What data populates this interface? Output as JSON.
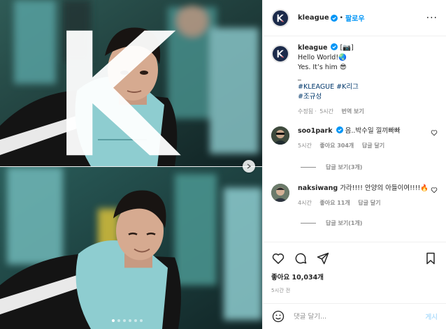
{
  "post": {
    "username": "kleague",
    "follow_label": "팔로우",
    "more_icon": "more-horizontal-icon",
    "caption": {
      "username": "kleague",
      "badge": "[📷]",
      "line1": "Hello World!🌏",
      "line2": "Yes. It’s him 😎",
      "line3": "_",
      "tags1": "#KLEAGUE #K리그",
      "tags2": "#조규성",
      "edited": "수정됨",
      "time": "5시간",
      "translate": "번역 보기"
    },
    "comments": [
      {
        "username": "soo1park",
        "text": "음..박수일 낄끼빠빠",
        "time": "5시간",
        "likes": "좋아요 304개",
        "reply": "답글 달기",
        "view_replies": "답글 보기(3개)"
      },
      {
        "username": "naksiwang",
        "text": "가라!!!! 안양의 아들이여!!!!🔥",
        "time": "4시간",
        "likes": "좋아요 11개",
        "reply": "답글 달기",
        "view_replies": "답글 보기(1개)"
      }
    ],
    "likes_total": "좋아요 10,034개",
    "posted_ago": "5시간 전",
    "add_comment_placeholder": "댓글 달기...",
    "post_button": "게시"
  },
  "colors": {
    "link_blue": "#0095f6",
    "hashtag": "#00376b",
    "muted": "#8e8e8e",
    "kleague_navy": "#1b2a4a",
    "bib_teal": "#8ecdd0"
  },
  "carousel": {
    "slides": 6,
    "active_index": 0
  }
}
